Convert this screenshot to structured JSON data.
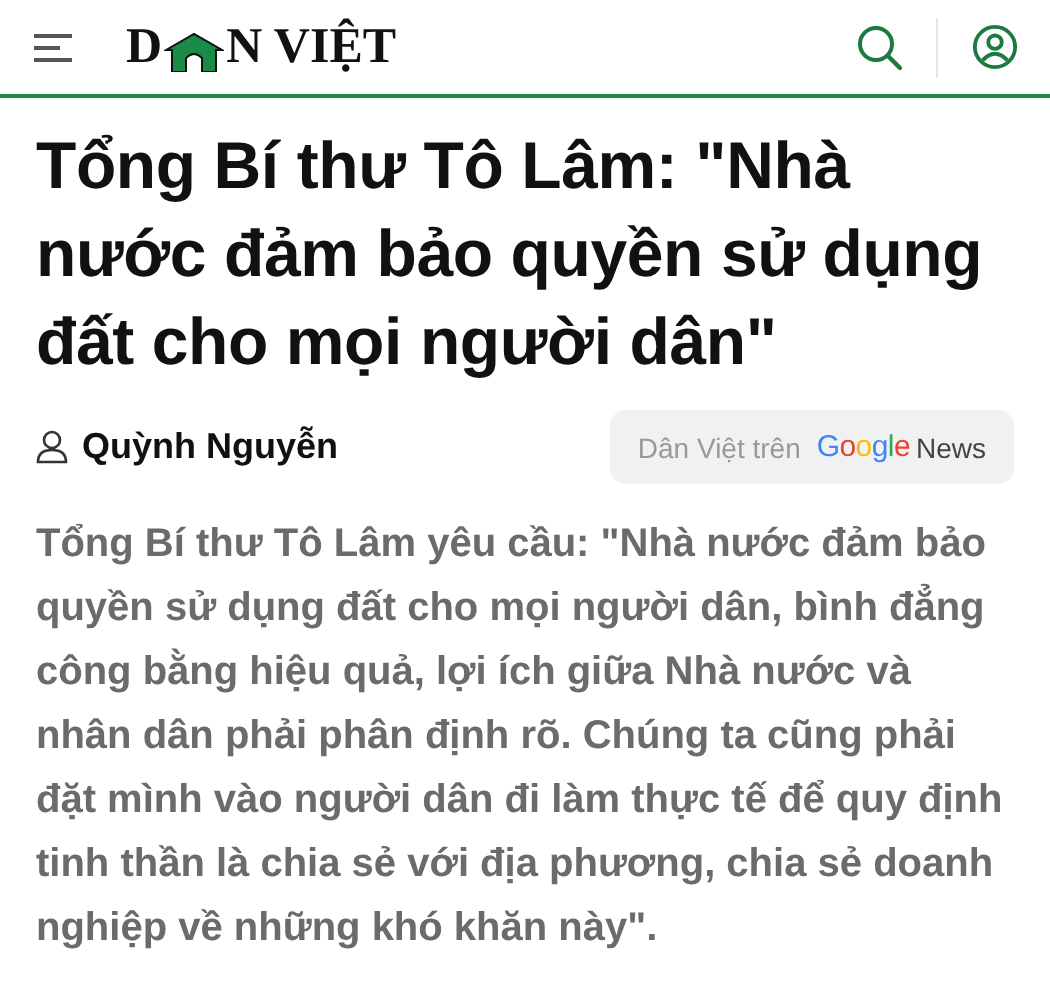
{
  "header": {
    "logo_before": "D",
    "logo_after": "N VIỆT"
  },
  "title": "Tổng Bí thư Tô Lâm: \"Nhà nước đảm bảo quyền sử dụng đất cho mọi người dân\"",
  "author": "Quỳnh Nguyễn",
  "google_news": {
    "prefix": "Dân Việt trên",
    "letters": [
      {
        "char": "G",
        "color": "#4285f4"
      },
      {
        "char": "o",
        "color": "#ea4335"
      },
      {
        "char": "o",
        "color": "#fbbc05"
      },
      {
        "char": "g",
        "color": "#4285f4"
      },
      {
        "char": "l",
        "color": "#34a853"
      },
      {
        "char": "e",
        "color": "#ea4335"
      }
    ],
    "suffix": "News"
  },
  "lead": "Tổng Bí thư Tô Lâm yêu cầu: \"Nhà nước đảm bảo quyền sử dụng đất cho mọi người dân, bình đẳng công bằng hiệu quả, lợi ích giữa Nhà nước và nhân dân phải phân định rõ. Chúng ta cũng phải đặt mình vào người dân đi làm thực tế để quy định tinh thần là chia sẻ với địa phương, chia sẻ doanh nghiệp về những khó khăn này\"."
}
